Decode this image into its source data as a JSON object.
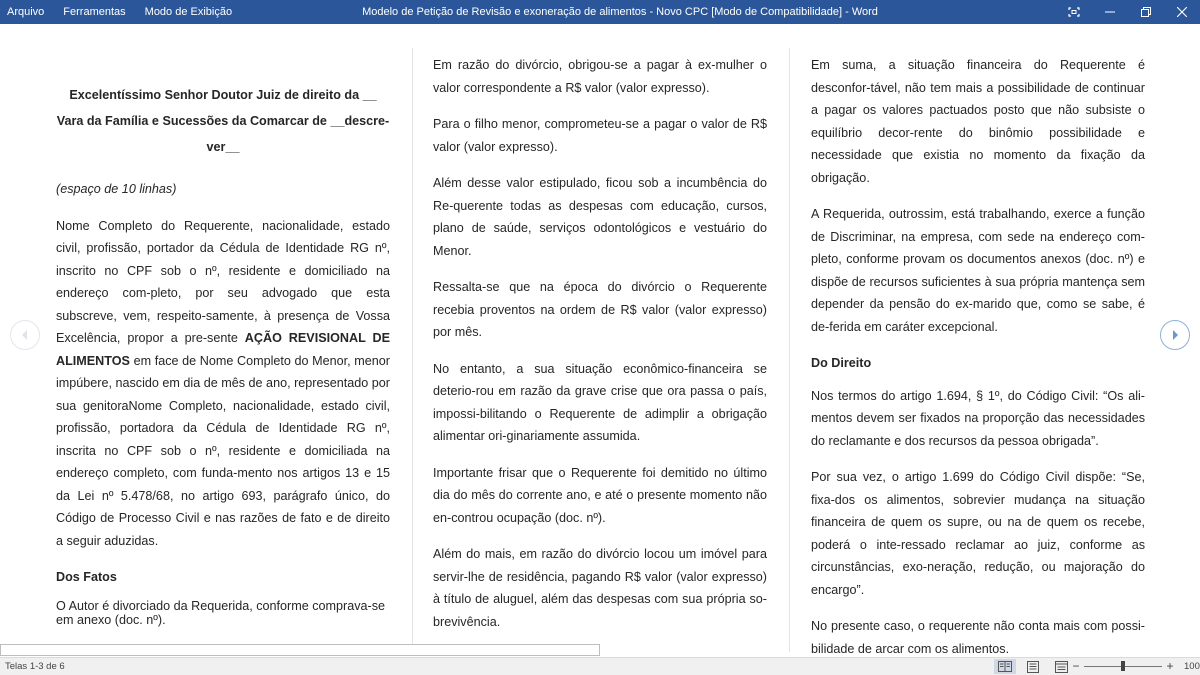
{
  "titlebar": {
    "menu": [
      "Arquivo",
      "Ferramentas",
      "Modo de Exibição"
    ],
    "title": "Modelo de Petição de Revisão e exoneração de alimentos - Novo CPC [Modo de Compatibilidade]  -  Word",
    "background": "#2b579a"
  },
  "document": {
    "col1": {
      "salutation": "Excelentíssimo Senhor Doutor Juiz de direito da __ Vara da Família e Sucessões da Comarcar de __descre-ver__",
      "spacing_note": "(espaço de 10 linhas)",
      "intro_before": "Nome Completo do Requerente, nacionalidade, estado civil, profissão, portador da Cédula de Identidade RG nº, inscrito no CPF sob o nº, residente e domiciliado na endereço com-pleto, por seu advogado que esta subscreve, vem, respeito-samente, à presença de Vossa Excelência, propor a pre-sente ",
      "action_name": "AÇÃO REVISIONAL DE ALIMENTOS",
      "intro_after": " em face de Nome Completo do Menor, menor impúbere, nascido em dia de mês de ano, representado por sua genitoraNome Completo, nacionalidade, estado civil, profissão, portadora da Cédula de Identidade RG nº, inscrita no CPF sob o nº, residente e domiciliada na endereço completo, com funda-mento nos artigos 13 e 15 da Lei nº 5.478/68, no artigo 693, parágrafo único, do Código de Processo Civil e nas razões de fato e de direito a seguir aduzidas.",
      "facts_heading": "Dos Fatos",
      "facts_p1": "O Autor é divorciado da Requerida, conforme comprava-se em anexo (doc. nº)."
    },
    "col2": {
      "p1": "Em razão do divórcio, obrigou-se a pagar à ex-mulher o valor correspondente a R$ valor (valor expresso).",
      "p2": "Para o filho menor, comprometeu-se a pagar o valor de R$ valor (valor expresso).",
      "p3": "Além desse valor estipulado, ficou sob a incumbência do Re-querente todas as despesas com educação, cursos, plano de saúde, serviços odontológicos e vestuário do Menor.",
      "p4": "Ressalta-se que na época do divórcio o Requerente recebia proventos na ordem de R$ valor (valor expresso) por mês.",
      "p5": "No entanto, a sua situação econômico-financeira se deterio-rou em razão da grave crise que ora passa o país, impossi-bilitando o Requerente de adimplir a obrigação alimentar ori-ginariamente assumida.",
      "p6": "Importante frisar que o Requerente foi demitido no último dia do mês do corrente ano, e até o presente momento não en-controu ocupação (doc. nº).",
      "p7": "Além do mais, em razão do divórcio locou um imóvel para servir-lhe de residência, pagando R$ valor (valor expresso) à título de aluguel, além das despesas com sua própria so-brevivência."
    },
    "col3": {
      "p1": "Em suma, a situação financeira do Requerente é desconfor-tável, não tem mais a possibilidade de continuar a pagar os valores pactuados posto que não subsiste o equilíbrio decor-rente do binômio possibilidade e necessidade que existia no momento da fixação da obrigação.",
      "p2": "A Requerida, outrossim, está trabalhando, exerce a função de Discriminar, na empresa, com sede na endereço com-pleto, conforme provam os documentos anexos (doc. nº) e dispõe de recursos suficientes à sua própria mantença sem depender da pensão do ex-marido que, como se sabe, é de-ferida em caráter excepcional.",
      "law_heading": "Do Direito",
      "p3": "Nos termos do artigo 1.694, § 1º, do Código Civil: “Os ali-mentos devem ser fixados na proporção das necessidades do reclamante e dos recursos da pessoa obrigada”.",
      "p4": "Por sua vez, o artigo 1.699 do Código Civil dispõe: “Se, fixa-dos os alimentos, sobrevier mudança na situação financeira de quem os supre, ou na de quem os recebe, poderá o inte-ressado reclamar ao juiz, conforme as circunstâncias, exo-neração, redução, ou majoração do encargo”.",
      "p5": "No presente caso, o requerente não conta mais com possi-bilidade de arcar com os alimentos."
    }
  },
  "statusbar": {
    "pages": "Telas 1-3 de 6",
    "zoom_level": "100%",
    "zoom_slider_fraction": 0.5,
    "views": [
      "read-mode-icon",
      "print-layout-icon",
      "web-layout-icon"
    ],
    "active_view": "read-mode-icon"
  },
  "nav": {
    "prev_icon": "chevron-left-icon",
    "next_icon": "chevron-right-icon"
  }
}
